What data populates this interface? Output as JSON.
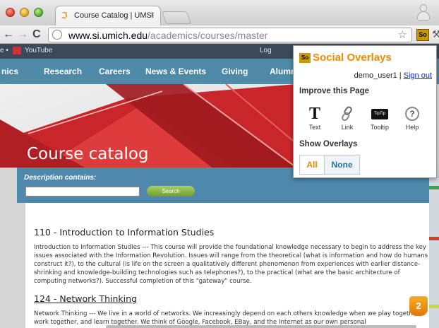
{
  "browser": {
    "tab": {
      "title": "Course Catalog | UMSI",
      "close": "×"
    },
    "nav": {
      "back": "←",
      "forward": "→",
      "reload": "C"
    },
    "url": {
      "domain": "www.si.umich.edu",
      "path": "/academics/courses/master"
    },
    "star": "☆",
    "extension_label": "So",
    "wrench": "⚒"
  },
  "bookmarks": {
    "partial": "e •",
    "youtube": "YouTube",
    "log": "Log"
  },
  "site": {
    "nav": [
      "nics",
      "Research",
      "Careers",
      "News & Events",
      "Giving",
      "Alumn"
    ],
    "banner_title": "Course catalog",
    "search": {
      "label": "Description contains:",
      "input_value": "",
      "button": "Search"
    }
  },
  "courses": [
    {
      "title": "110 - Introduction to Information Studies",
      "description": "Introduction to Information Studies --- This course will provide the foundational knowledge necessary to begin to address the key issues associated with the Information Revolution. Issues will range from the theoretical (what is information and how do humans construct it?), to the cultural (is life on the screen a qualitatively different phenomenon from experiences with earlier distance-shrinking and knowledge-building technologies such as telephones?), to the practical (what are the basic architecture of computing networks?). Successful completion of this \"gateway\" course."
    },
    {
      "title": "124 - Network Thinking",
      "description": "Network Thinking --- We live in a world of networks. We increasingly depend on each others knowledge when we play together, work together, and learn together. We think of Google, Facebook, EBay, and the Internet as our own personal"
    }
  ],
  "popup": {
    "logo": "So",
    "title": "Social Overlays",
    "user": "demo_user1",
    "separator": "|",
    "signout": "Sign out",
    "improve_heading": "Improve this Page",
    "tools": [
      {
        "label": "Text",
        "icon": "text-icon",
        "glyph": "T"
      },
      {
        "label": "Link",
        "icon": "link-icon",
        "glyph": "⛓"
      },
      {
        "label": "Tooltip",
        "icon": "tooltip-icon",
        "glyph": "TipTip"
      },
      {
        "label": "Help",
        "icon": "help-icon",
        "glyph": "?"
      }
    ],
    "overlays_heading": "Show Overlays",
    "overlay_buttons": {
      "all": "All",
      "none": "None"
    }
  },
  "notification_count": "2",
  "colors": {
    "accent_orange": "#f08c00",
    "site_blue": "#4f8aa8",
    "extension_gold": "#c79a00"
  }
}
